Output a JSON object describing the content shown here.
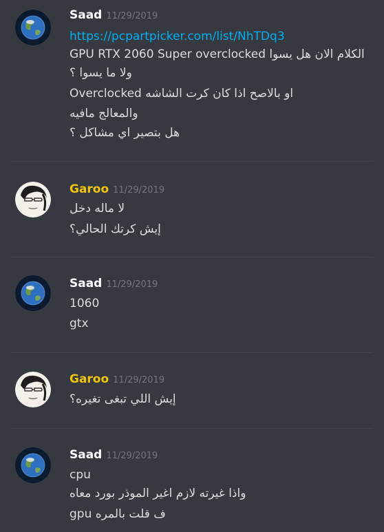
{
  "colors": {
    "background": "#36393f",
    "saad_name": "#ffffff",
    "garoo_name": "#f1c40f",
    "timestamp": "#72767d",
    "text": "#dcddde",
    "link": "#00b0f4"
  },
  "messages": [
    {
      "author": "Saad",
      "timestamp": "11/29/2019",
      "avatar_icon": "earth-globe-icon",
      "lines": [
        "https://pcpartpicker.com/list/NhTDq3",
        "الكلام الان هل يسوا GPU RTX 2060 Super overclocked",
        "ولا ما يسوا ؟",
        "او بالاصح اذا كان كرت الشاشه Overclocked",
        "والمعالج مافيه",
        "هل بتصير اي مشاكل ؟"
      ]
    },
    {
      "author": "Garoo",
      "timestamp": "11/29/2019",
      "avatar_icon": "anime-character-avatar-icon",
      "lines": [
        "لا ماله دخل",
        "إيش كرتك الحالي؟"
      ]
    },
    {
      "author": "Saad",
      "timestamp": "11/29/2019",
      "avatar_icon": "earth-globe-icon",
      "lines": [
        "1060",
        "gtx"
      ]
    },
    {
      "author": "Garoo",
      "timestamp": "11/29/2019",
      "avatar_icon": "anime-character-avatar-icon",
      "lines": [
        "إيش اللي تبغى تغيره؟"
      ]
    },
    {
      "author": "Saad",
      "timestamp": "11/29/2019",
      "avatar_icon": "earth-globe-icon",
      "lines": [
        "cpu",
        "واذا غيرته لازم اغير الموذر بورد معاه",
        "ف قلت بالمره gpu"
      ]
    }
  ]
}
